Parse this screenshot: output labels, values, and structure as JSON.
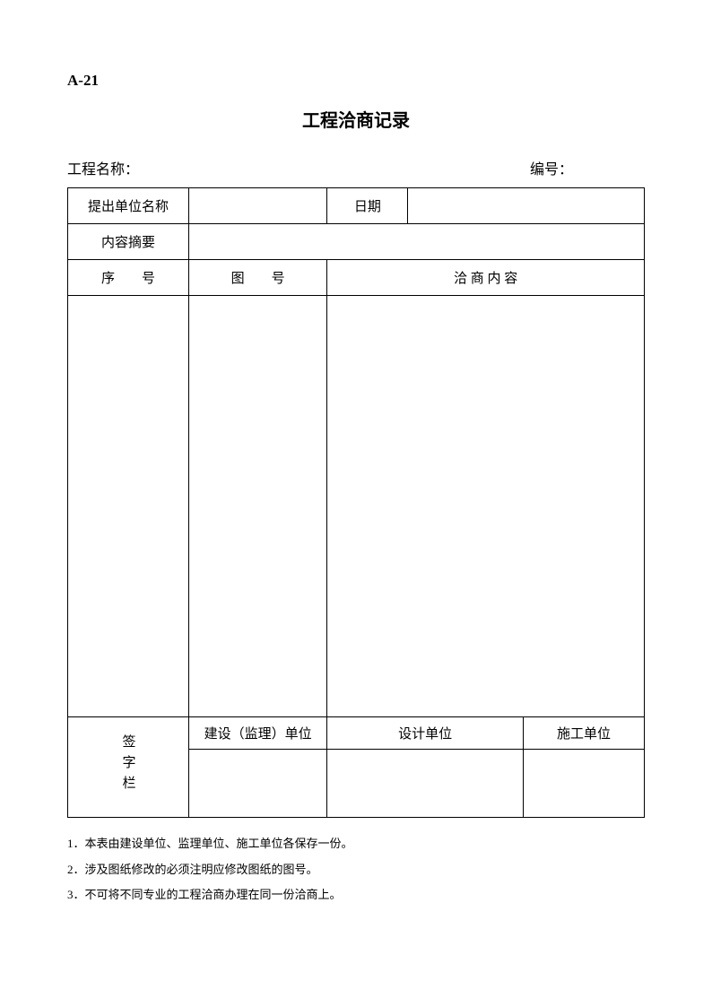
{
  "form_code": "A-21",
  "title": "工程洽商记录",
  "project_name_label": "工程名称：",
  "form_number_label": "编号：",
  "row1": {
    "label1": "提出单位名称",
    "value1": "",
    "label2": "日期",
    "value2": ""
  },
  "row2": {
    "label": "内容摘要",
    "value": ""
  },
  "headers": {
    "seq": "序　　号",
    "drawing": "图　　号",
    "content": "洽 商 内 容"
  },
  "signature": {
    "label": "签字栏",
    "col1": "建设（监理）单位",
    "col2": "设计单位",
    "col3": "施工单位"
  },
  "notes": [
    "1．本表由建设单位、监理单位、施工单位各保存一份。",
    "2．涉及图纸修改的必须注明应修改图纸的图号。",
    "3．不可将不同专业的工程洽商办理在同一份洽商上。"
  ]
}
